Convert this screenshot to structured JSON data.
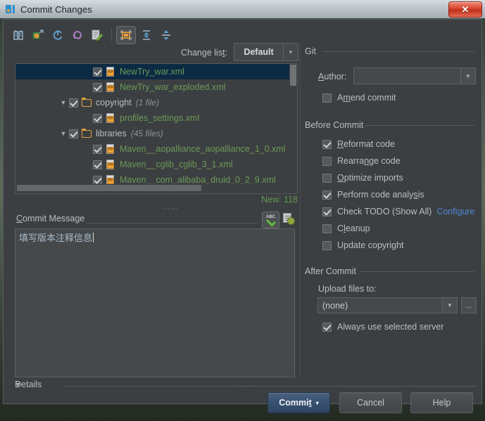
{
  "window": {
    "title": "Commit Changes",
    "app_icon": "intellij-idea-icon",
    "close_label": "✕"
  },
  "toolbar": {
    "buttons": [
      {
        "name": "show-diff-icon",
        "label": ""
      },
      {
        "name": "revert-icon",
        "label": ""
      },
      {
        "name": "refresh-icon",
        "label": ""
      },
      {
        "name": "rollback-icon",
        "label": ""
      },
      {
        "name": "edit-source-icon",
        "label": ""
      },
      {
        "name": "group-by-directory-icon",
        "label": "",
        "selected": true
      },
      {
        "name": "expand-all-icon",
        "label": ""
      },
      {
        "name": "collapse-all-icon",
        "label": ""
      }
    ],
    "changelist_label": "Change list:",
    "changelist_value": "Default",
    "changelist_arrow": "▼"
  },
  "tree": {
    "rows": [
      {
        "indent": 3,
        "twisty": "",
        "checked": true,
        "icon": "xml-file-icon",
        "name": "NewTry_war.xml",
        "count": "",
        "color": "green",
        "selected": true
      },
      {
        "indent": 3,
        "twisty": "",
        "checked": true,
        "icon": "xml-file-icon",
        "name": "NewTry_war_exploded.xml",
        "count": "",
        "color": "green",
        "selected": false
      },
      {
        "indent": 2,
        "twisty": "▼",
        "checked": true,
        "icon": "folder-icon",
        "name": "copyright",
        "count": "(1 file)",
        "color": "plain",
        "selected": false
      },
      {
        "indent": 3,
        "twisty": "",
        "checked": true,
        "icon": "xml-file-icon",
        "name": "profiles_settings.xml",
        "count": "",
        "color": "green",
        "selected": false
      },
      {
        "indent": 2,
        "twisty": "▼",
        "checked": true,
        "icon": "folder-icon",
        "name": "libraries",
        "count": "(45 files)",
        "color": "plain",
        "selected": false
      },
      {
        "indent": 3,
        "twisty": "",
        "checked": true,
        "icon": "xml-file-icon",
        "name": "Maven__aopalliance_aopalliance_1_0.xml",
        "count": "",
        "color": "green",
        "selected": false
      },
      {
        "indent": 3,
        "twisty": "",
        "checked": true,
        "icon": "xml-file-icon",
        "name": "Maven__cglib_cglib_3_1.xml",
        "count": "",
        "color": "green",
        "selected": false
      },
      {
        "indent": 3,
        "twisty": "",
        "checked": true,
        "icon": "xml-file-icon",
        "name": "Maven__com_alibaba_druid_0_2_9.xml",
        "count": "",
        "color": "green",
        "selected": false
      }
    ],
    "new_count": "New: 118"
  },
  "commit_message": {
    "label": "Commit Message",
    "label_mnemonic": "C",
    "value": "填写版本注释信息",
    "spellcheck_icon": "spellcheck-abc-icon",
    "history_icon": "message-history-icon"
  },
  "details": {
    "twisty": "▼",
    "label": "Details"
  },
  "git": {
    "section_title": "Git",
    "author_label": "Author:",
    "author_mnemonic": "A",
    "author_value": "",
    "author_arrow": "▼",
    "amend_label": "Amend commit",
    "amend_mnemonic": "m",
    "amend_checked": false
  },
  "before_commit": {
    "section_title": "Before Commit",
    "items": [
      {
        "label": "Reformat code",
        "mnemonic": "R",
        "checked": true
      },
      {
        "label": "Rearrange code",
        "mnemonic": "n",
        "checked": false
      },
      {
        "label": "Optimize imports",
        "mnemonic": "O",
        "checked": false
      },
      {
        "label": "Perform code analysis",
        "mnemonic": "s",
        "checked": true
      },
      {
        "label": "Check TODO (Show All)",
        "mnemonic": "",
        "checked": true,
        "link": "Configure"
      },
      {
        "label": "Cleanup",
        "mnemonic": "l",
        "checked": false
      },
      {
        "label": "Update copyright",
        "mnemonic": "",
        "checked": false
      }
    ]
  },
  "after_commit": {
    "section_title": "After Commit",
    "upload_label": "Upload files to:",
    "upload_value": "(none)",
    "upload_arrow": "▼",
    "browse_label": "...",
    "always_label": "Always use selected server",
    "always_checked": true
  },
  "buttons": {
    "commit": "Commit",
    "commit_mnemonic": "t",
    "commit_arrow": "▾",
    "cancel": "Cancel",
    "help": "Help"
  },
  "colors": {
    "accent_green": "#6a9a57",
    "link_blue": "#4c87d6",
    "selection": "#0d2a44",
    "panel_bg": "#3c3f41",
    "field_bg": "#45494a"
  }
}
